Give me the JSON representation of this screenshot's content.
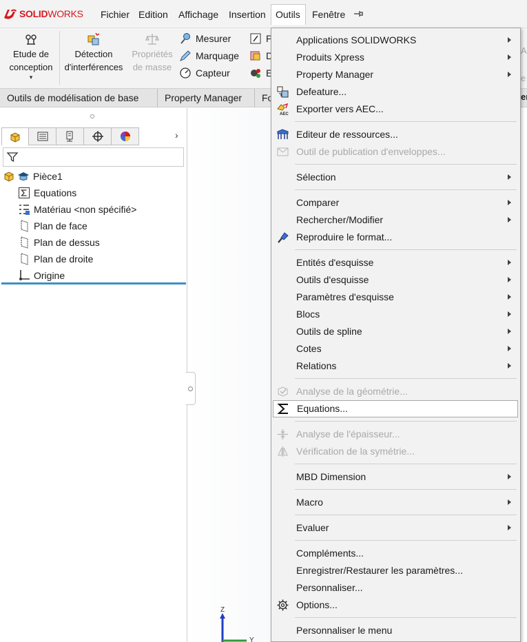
{
  "app": {
    "brand": "SOLIDWORKS",
    "brand_prefix": "SOLID",
    "brand_suffix": "WORKS"
  },
  "menubar": {
    "items": [
      {
        "label": "Fichier"
      },
      {
        "label": "Edition"
      },
      {
        "label": "Affichage"
      },
      {
        "label": "Insertion"
      },
      {
        "label": "Outils"
      },
      {
        "label": "Fenêtre"
      }
    ]
  },
  "commands": {
    "etude": {
      "line1": "Etude de",
      "line2": "conception"
    },
    "detection": {
      "line1": "Détection",
      "line2": "d'interférences"
    },
    "proprietes": {
      "line1": "Propriétés",
      "line2": "de masse"
    },
    "mesurer": "Mesurer",
    "marquage": "Marquage",
    "capteur": "Capteur",
    "frag_p": "P",
    "frag_d": "D",
    "frag_e": "E"
  },
  "tabs": [
    {
      "label": "Outils de modélisation de base"
    },
    {
      "label": "Property Manager"
    },
    {
      "label": "Fo"
    }
  ],
  "feature_tree": {
    "items": [
      {
        "label": "Pièce1"
      },
      {
        "label": "Equations"
      },
      {
        "label": "Matériau <non spécifié>"
      },
      {
        "label": "Plan de face"
      },
      {
        "label": "Plan de dessus"
      },
      {
        "label": "Plan de droite"
      },
      {
        "label": "Origine"
      }
    ]
  },
  "triad": {
    "z": "Z",
    "y": "Y"
  },
  "outils_menu": {
    "items": [
      {
        "label": "Applications SOLIDWORKS",
        "submenu": true
      },
      {
        "label": "Produits Xpress",
        "submenu": true
      },
      {
        "label": "Property Manager",
        "submenu": true
      },
      {
        "label": "Defeature...",
        "icon": "defeature-icon"
      },
      {
        "label": "Exporter vers AEC...",
        "icon": "export-aec-icon"
      },
      {
        "label": "Editeur de ressources...",
        "icon": "resource-editor-icon"
      },
      {
        "label": "Outil de publication d'enveloppes...",
        "icon": "envelope-publisher-icon",
        "disabled": true
      },
      {
        "label": "Sélection",
        "submenu": true
      },
      {
        "label": "Comparer",
        "submenu": true
      },
      {
        "label": "Rechercher/Modifier",
        "submenu": true
      },
      {
        "label": "Reproduire le format...",
        "icon": "format-painter-icon"
      },
      {
        "label": "Entités d'esquisse",
        "submenu": true
      },
      {
        "label": "Outils d'esquisse",
        "submenu": true
      },
      {
        "label": "Paramètres d'esquisse",
        "submenu": true
      },
      {
        "label": "Blocs",
        "submenu": true
      },
      {
        "label": "Outils de spline",
        "submenu": true
      },
      {
        "label": "Cotes",
        "submenu": true
      },
      {
        "label": "Relations",
        "submenu": true
      },
      {
        "label": "Analyse de la géométrie...",
        "icon": "geometry-analysis-icon",
        "disabled": true
      },
      {
        "label": "Equations...",
        "icon": "sigma-icon",
        "highlighted": true
      },
      {
        "label": "Analyse de l'épaisseur...",
        "icon": "thickness-analysis-icon",
        "disabled": true
      },
      {
        "label": "Vérification de la symétrie...",
        "icon": "symmetry-check-icon",
        "disabled": true
      },
      {
        "label": "MBD Dimension",
        "submenu": true
      },
      {
        "label": "Macro",
        "submenu": true
      },
      {
        "label": "Evaluer",
        "submenu": true
      },
      {
        "label": "Compléments..."
      },
      {
        "label": "Enregistrer/Restaurer les paramètres..."
      },
      {
        "label": "Personnaliser..."
      },
      {
        "label": "Options...",
        "icon": "gear-icon"
      },
      {
        "label": "Personnaliser le menu"
      }
    ]
  },
  "colors": {
    "brand_red": "#d71920",
    "accent_blue": "#3c8fcb",
    "menu_bg": "#f2f2f2",
    "disabled_text": "#a9a9a9"
  }
}
